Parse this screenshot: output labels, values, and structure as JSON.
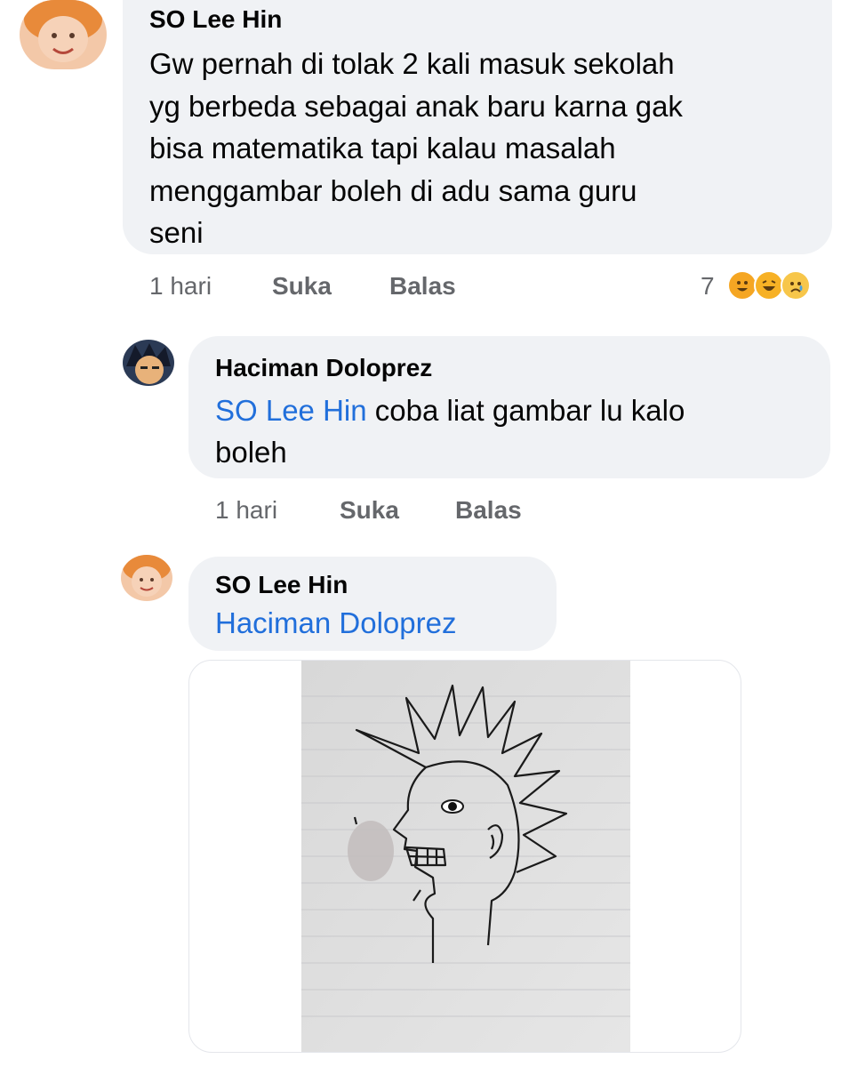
{
  "comments": [
    {
      "author": "SO Lee Hin",
      "text": "Gw pernah di tolak 2 kali masuk sekolah yg berbeda sebagai anak baru karna gak bisa matematika tapi kalau masalah menggambar boleh di adu sama guru seni",
      "lines": [
        "Gw pernah di tolak 2 kali masuk sekolah",
        "yg berbeda sebagai anak baru karna gak",
        "bisa matematika tapi kalau masalah",
        "menggambar boleh di adu sama guru",
        "seni"
      ],
      "time": "1 hari",
      "like_label": "Suka",
      "reply_label": "Balas",
      "reaction_count": "7",
      "reactions": [
        "haha-icon",
        "laugh-icon",
        "sad-icon"
      ]
    },
    {
      "author": "Haciman Doloprez",
      "mention": "SO Lee Hin",
      "text_line1": " coba liat gambar lu kalo",
      "text_line2": "boleh",
      "time": "1 hari",
      "like_label": "Suka",
      "reply_label": "Balas"
    },
    {
      "author": "SO Lee Hin",
      "mention": "Haciman Doloprez",
      "attachment": "drawing-photo"
    }
  ],
  "colors": {
    "bubble": "#f0f2f5",
    "mention": "#216fdb",
    "meta": "#65676b"
  }
}
